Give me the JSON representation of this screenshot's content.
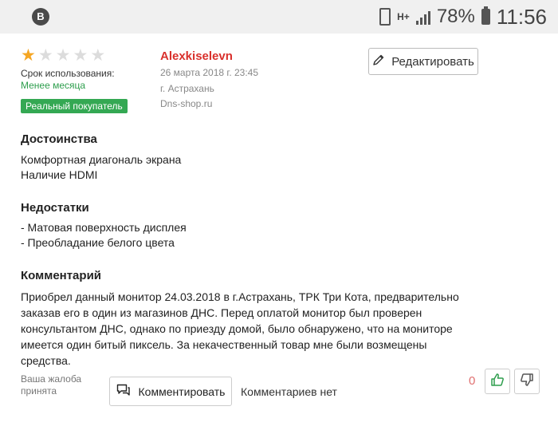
{
  "status_bar": {
    "app_letter": "B",
    "network": "H+",
    "battery_pct": "78%",
    "time": "11:56"
  },
  "review": {
    "rating": 1,
    "rating_max": 5,
    "usage_label": "Срок использования:",
    "usage_value": "Менее месяца",
    "badge": "Реальный покупатель",
    "author": "Alexkiselevn",
    "date": "26 марта 2018 г. 23:45",
    "city": "г. Астрахань",
    "shop": "Dns-shop.ru",
    "edit_label": "Редактировать",
    "pros_title": "Достоинства",
    "pros": [
      "Комфортная диагональ экрана",
      "Наличие HDMI"
    ],
    "cons_title": "Недостатки",
    "cons": [
      "- Матовая поверхность дисплея",
      "- Преобладание белого цвета"
    ],
    "comment_title": "Комментарий",
    "comment_text": "Приобрел данный монитор 24.03.2018 в г.Астрахань, ТРК Три Кота, предварительно заказав его в один из магазинов ДНС. Перед оплатой монитор был проверен консультантом ДНС, однако по приезду домой, было обнаружено, что на мониторе имеется один битый пиксель. За некачественный товар мне были возмещены средства.",
    "complaint_text": "Ваша жалоба принята",
    "comment_button": "Комментировать",
    "no_comments": "Комментариев нет",
    "vote_count": "0"
  },
  "colors": {
    "star_on": "#f5a623",
    "author": "#d9302c",
    "badge_bg": "#34a853",
    "thumb_up": "#2e9e4d"
  },
  "icons": {
    "edit": "pencil-icon",
    "comment": "comment-icon",
    "like": "thumbs-up-icon",
    "dislike": "thumbs-down-icon"
  }
}
